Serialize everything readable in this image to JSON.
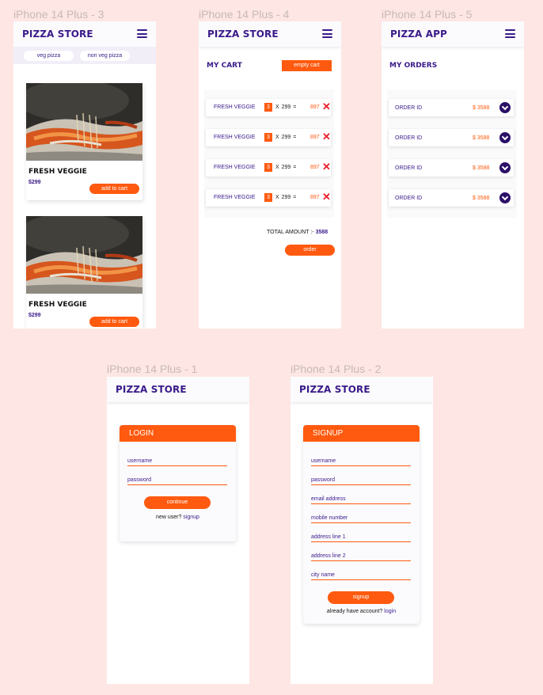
{
  "frames": {
    "f3": {
      "title": "iPhone 14 Plus - 3",
      "brand": "PIZZA STORE",
      "chips": [
        "veg pizza",
        "non veg pizza"
      ],
      "products": [
        {
          "name": "FRESH VEGGIE",
          "price": "$299",
          "button": "add to cart"
        },
        {
          "name": "FRESH VEGGIE",
          "price": "$299",
          "button": "add to cart"
        }
      ]
    },
    "f4": {
      "title": "iPhone 14 Plus - 4",
      "brand": "PIZZA STORE",
      "section": "MY CART",
      "empty_button": "empty cart",
      "items": [
        {
          "name": "FRESH VEGGIE",
          "qty": "3",
          "calc": "X 299 =",
          "subtotal": "897"
        },
        {
          "name": "FRESH VEGGIE",
          "qty": "3",
          "calc": "X 299 =",
          "subtotal": "897"
        },
        {
          "name": "FRESH VEGGIE",
          "qty": "3",
          "calc": "X 299 =",
          "subtotal": "897"
        },
        {
          "name": "FRESH VEGGIE",
          "qty": "3",
          "calc": "X 299 =",
          "subtotal": "897"
        }
      ],
      "total_label": "TOTAL AMOUNT :-",
      "total_value": "3588",
      "order_button": "order"
    },
    "f5": {
      "title": "iPhone 14 Plus - 5",
      "brand": "PIZZA APP",
      "section": "MY ORDERS",
      "orders": [
        {
          "label": "ORDER ID",
          "amount": "$ 3588"
        },
        {
          "label": "ORDER ID",
          "amount": "$ 3588"
        },
        {
          "label": "ORDER ID",
          "amount": "$ 3588"
        },
        {
          "label": "ORDER ID",
          "amount": "$ 3588"
        }
      ]
    },
    "f1": {
      "title": "iPhone 14 Plus - 1",
      "brand": "PIZZA STORE",
      "form_title": "LOGIN",
      "fields": [
        "username",
        "password"
      ],
      "button": "continue",
      "alt_text": "new user?",
      "alt_link": "signup"
    },
    "f2": {
      "title": "iPhone 14 Plus - 2",
      "brand": "PIZZA STORE",
      "form_title": "SIGNUP",
      "fields": [
        "username",
        "password",
        "email address",
        "mobile number",
        "address line 1",
        "address line 2",
        "city name"
      ],
      "button": "signup",
      "alt_text": "already have account?",
      "alt_link": "login"
    }
  },
  "colors": {
    "canvas": "#fde6e4",
    "primary": "#3a1a8a",
    "accent": "#ff5a0f",
    "delete": "#e8202a"
  },
  "icons": [
    "hamburger-menu-icon",
    "delete-x-icon",
    "chevron-down-circle-icon",
    "pizza-photo"
  ]
}
